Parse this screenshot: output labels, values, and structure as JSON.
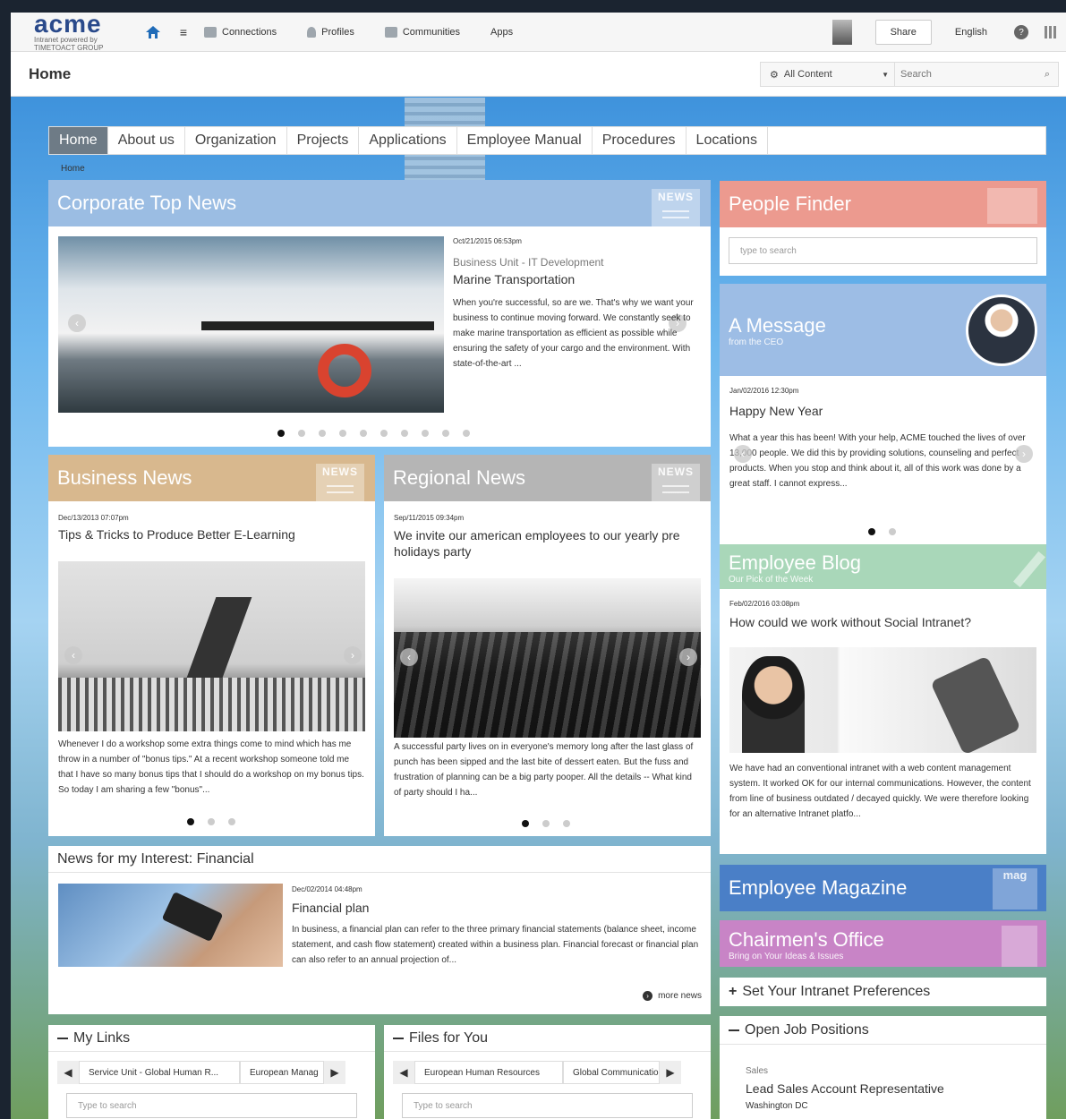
{
  "brand": {
    "name": "acme",
    "sub1": "Intranet powered by",
    "sub2": "TIMETOACT GROUP"
  },
  "topnav": {
    "connections": "Connections",
    "profiles": "Profiles",
    "communities": "Communities",
    "apps": "Apps"
  },
  "topright": {
    "share": "Share",
    "language": "English",
    "help": "?"
  },
  "subbar": {
    "title": "Home",
    "scope": "All Content",
    "search_placeholder": "Search"
  },
  "mainnav": [
    "Home",
    "About us",
    "Organization",
    "Projects",
    "Applications",
    "Employee Manual",
    "Procedures",
    "Locations"
  ],
  "breadcrumb": "Home",
  "corporate": {
    "title": "Corporate Top News",
    "badge": "NEWS",
    "date": "Oct/21/2015 06:53pm",
    "unit": "Business Unit - IT Development",
    "headline": "Marine Transportation",
    "text": "When you're successful, so are we. That's why we want your business to continue moving forward. We constantly seek to make marine transportation as efficient as possible while ensuring the safety of your cargo and the environment. With state-of-the-art ..."
  },
  "business": {
    "title": "Business News",
    "badge": "NEWS",
    "date": "Dec/13/2013 07:07pm",
    "headline": "Tips & Tricks to Produce Better E-Learning",
    "text": "Whenever I do a workshop some extra things come to mind which has me throw in a number of \"bonus tips.\" At a recent workshop someone told me that I have so many bonus tips that I should do a workshop on my bonus tips. So today I am sharing a few \"bonus\"..."
  },
  "regional": {
    "title": "Regional News",
    "badge": "NEWS",
    "date": "Sep/11/2015 09:34pm",
    "headline": "We invite our american employees to our yearly pre holidays party",
    "text": "A successful party lives on in everyone's memory long after the last glass of punch has been sipped and the last bite of dessert eaten. But the fuss and frustration of planning can be a big party pooper. All the details -- What kind of party should I ha..."
  },
  "interest": {
    "title": "News for my Interest: Financial",
    "date": "Dec/02/2014 04:48pm",
    "headline": "Financial plan",
    "text": "In business, a financial plan can refer to the three primary financial statements (balance sheet, income statement, and cash flow statement) created within a business plan. Financial forecast or financial plan can also refer to an annual projection of...",
    "more": "more news"
  },
  "mylinks": {
    "title": "My Links",
    "tab1": "Service Unit - Global Human R...",
    "tab2": "European Manag",
    "placeholder": "Type to search"
  },
  "files": {
    "title": "Files for You",
    "tab1": "European Human Resources",
    "tab2": "Global Communicatio",
    "placeholder": "Type to search"
  },
  "people": {
    "title": "People Finder",
    "placeholder": "type to search"
  },
  "message": {
    "title": "A Message",
    "subtitle": "from the CEO",
    "date": "Jan/02/2016 12:30pm",
    "headline": "Happy New Year",
    "text": "What a year this has been! With your help, ACME touched the lives of over 13,000 people. We did this by providing solutions, counseling and perfect products. When you stop and think about it, all of this work was done by a great staff. I cannot express..."
  },
  "blog": {
    "title": "Employee Blog",
    "subtitle": "Our Pick of the Week",
    "date": "Feb/02/2016 03:08pm",
    "headline": "How could we work without Social Intranet?",
    "text": "We have had an conventional intranet with a web content management system. It worked OK for our internal communications. However, the content from line of business outdated / decayed quickly. We were therefore looking for an alternative Intranet platfo..."
  },
  "magazine": {
    "title": "Employee Magazine",
    "badge": "mag"
  },
  "chairman": {
    "title": "Chairmen's Office",
    "subtitle": "Bring on Your Ideas & Issues"
  },
  "prefs": {
    "title": "Set Your Intranet Preferences"
  },
  "jobs": {
    "title": "Open Job Positions",
    "dept": "Sales",
    "position": "Lead Sales Account Representative",
    "location": "Washington DC"
  },
  "colors": {
    "corporate": "#9bbde3",
    "business": "#d8b88e",
    "regional": "#b5b5b5",
    "people": "#ec9a8f",
    "message": "#9dbde5",
    "blog": "#a9d7b9",
    "magazine": "#4a7fc7",
    "chairman": "#c884c6"
  }
}
